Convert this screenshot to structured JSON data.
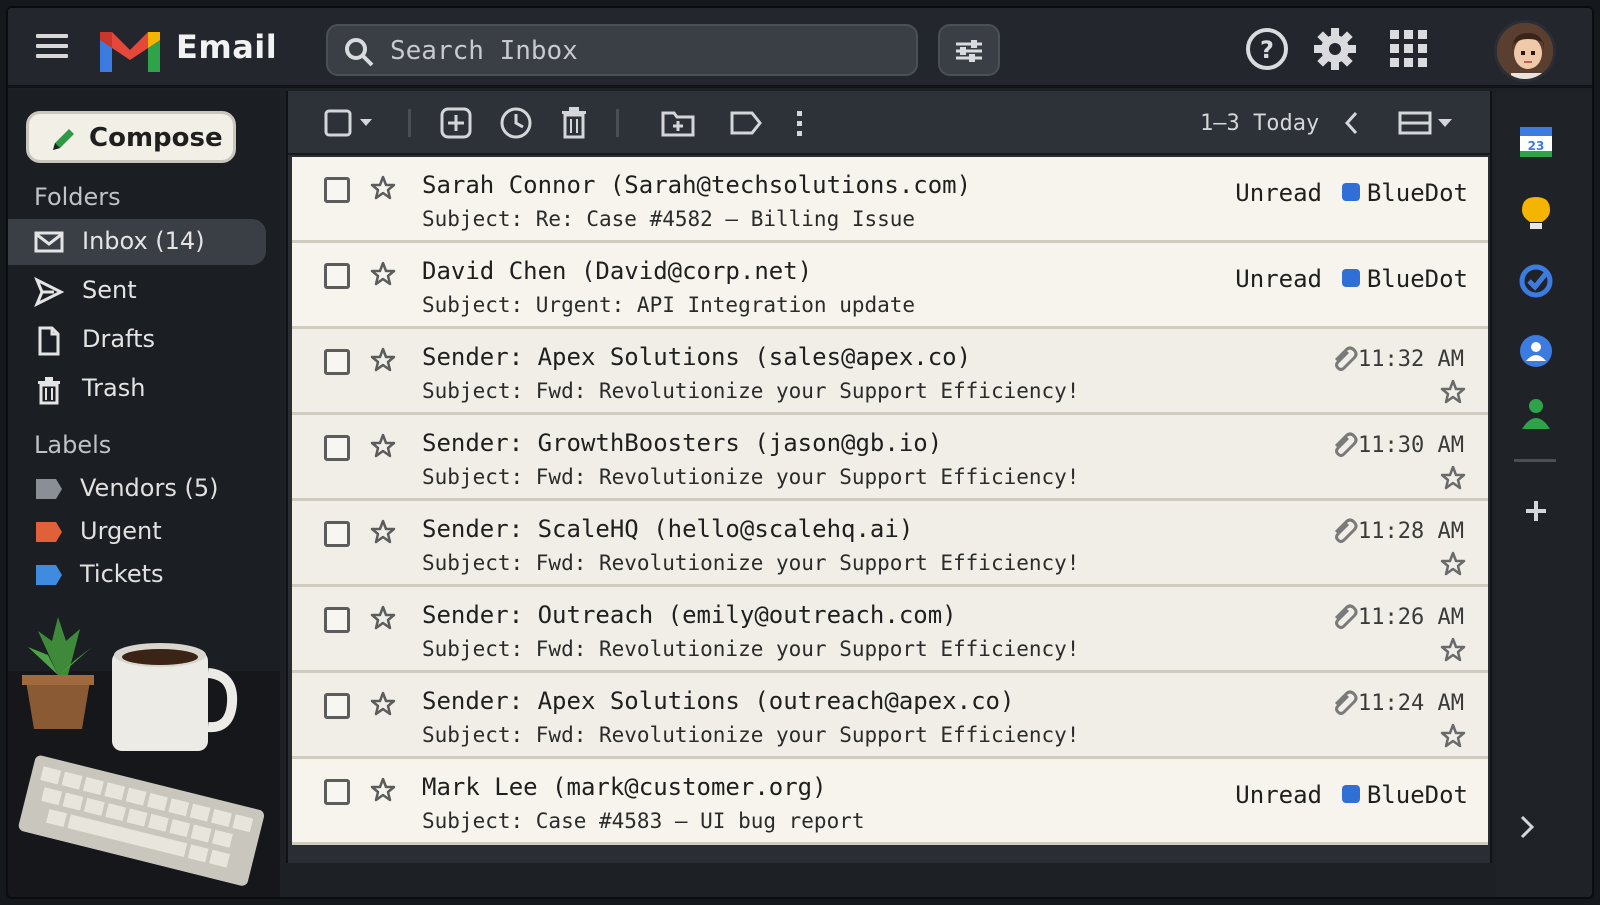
{
  "header": {
    "app_title": "Email",
    "search_placeholder": "Search Inbox"
  },
  "compose": {
    "label": "Compose"
  },
  "folders": {
    "heading": "Folders",
    "items": [
      {
        "label": "Inbox (14)",
        "icon": "envelope-icon",
        "active": true
      },
      {
        "label": "Sent",
        "icon": "send-icon"
      },
      {
        "label": "Drafts",
        "icon": "file-icon"
      },
      {
        "label": "Trash",
        "icon": "trash-icon"
      }
    ]
  },
  "labels": {
    "heading": "Labels",
    "items": [
      {
        "label": "Vendors (5)",
        "color": "#8a8f96"
      },
      {
        "label": "Urgent",
        "color": "#e0603a"
      },
      {
        "label": "Tickets",
        "color": "#3f8be0"
      }
    ]
  },
  "toolbar": {
    "range": "1–3 Today"
  },
  "emails": [
    {
      "from": "Sarah Connor (Sarah@techsolutions.com)",
      "subject": "Subject: Re: Case #4582 – Billing Issue",
      "status": "Unread",
      "tag": "BlueDot"
    },
    {
      "from": "David Chen (David@corp.net)",
      "subject": "Subject: Urgent: API Integration update",
      "status": "Unread",
      "tag": "BlueDot"
    },
    {
      "from": "Sender: Apex Solutions (sales@apex.co)",
      "subject": "Subject: Fwd: Revolutionize your Support Efficiency!",
      "time": "11:32 AM"
    },
    {
      "from": "Sender: GrowthBoosters (jason@gb.io)",
      "subject": "Subject: Fwd: Revolutionize your Support Efficiency!",
      "time": "11:30 AM"
    },
    {
      "from": "Sender: ScaleHQ (hello@scalehq.ai)",
      "subject": "Subject: Fwd: Revolutionize your Support Efficiency!",
      "time": "11:28 AM"
    },
    {
      "from": "Sender: Outreach (emily@outreach.com)",
      "subject": "Subject: Fwd: Revolutionize your Support Efficiency!",
      "time": "11:26 AM"
    },
    {
      "from": "Sender: Apex Solutions (outreach@apex.co)",
      "subject": "Subject: Fwd: Revolutionize your Support Efficiency!",
      "time": "11:24 AM"
    },
    {
      "from": "Mark Lee (mark@customer.org)",
      "subject": "Subject: Case #4583 – UI bug report",
      "status": "Unread",
      "tag": "BlueDot"
    }
  ],
  "rail": {
    "calendar_day": "23"
  },
  "colors": {
    "accent_blue": "#2f6fd6",
    "row_bg": "#f0eee6",
    "chrome": "#23272d"
  }
}
